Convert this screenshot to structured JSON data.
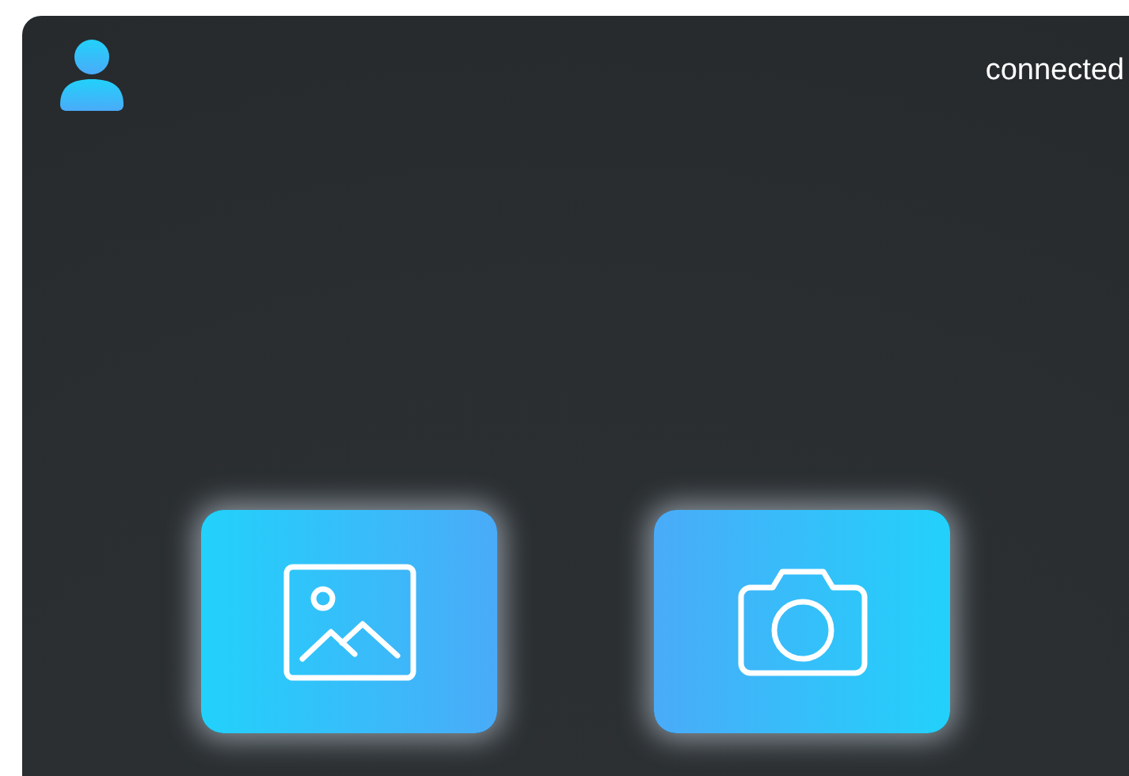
{
  "header": {
    "status": "connected"
  },
  "actions": [
    {
      "kind": "gallery"
    },
    {
      "kind": "camera"
    }
  ]
}
